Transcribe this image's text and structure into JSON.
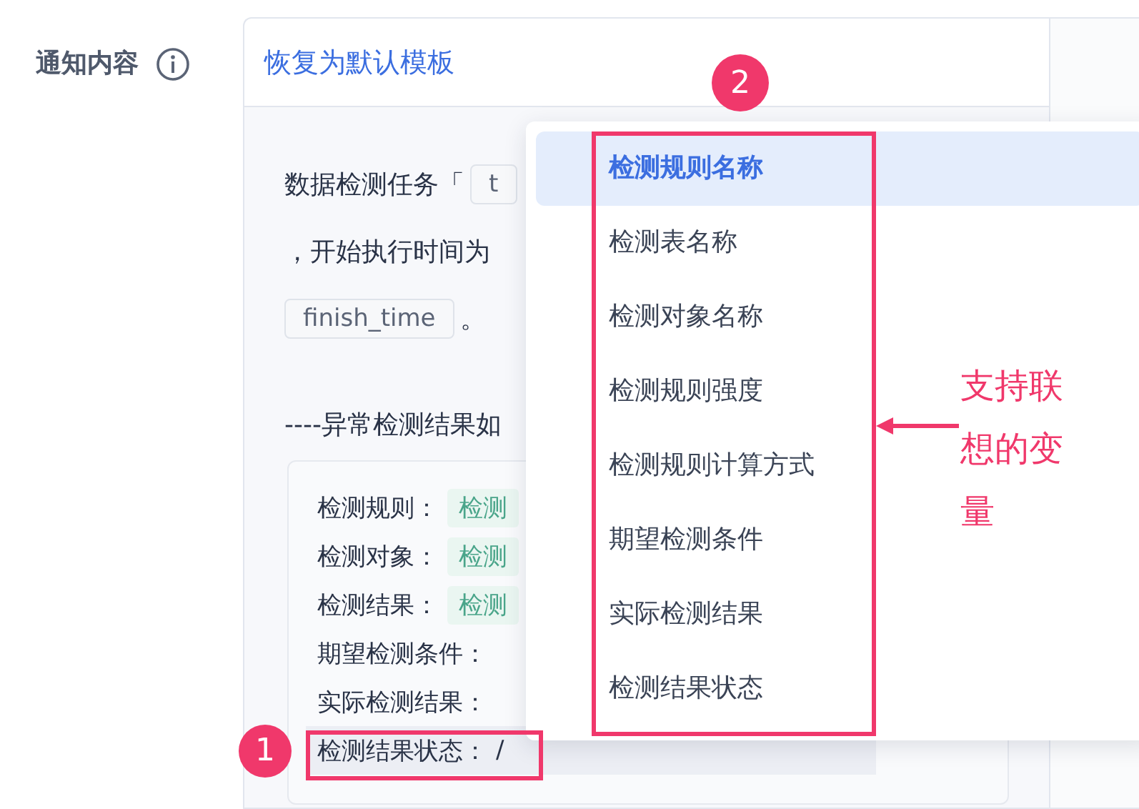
{
  "field": {
    "label": "通知内容",
    "reset_link": "恢复为默认模板"
  },
  "template": {
    "lines": [
      [
        {
          "kind": "text",
          "text": "数据检测任务「"
        },
        {
          "kind": "chip",
          "text": "t"
        }
      ],
      [
        {
          "kind": "text",
          "text": "，开始执行时间为"
        }
      ],
      [
        {
          "kind": "chip",
          "text": "finish_time"
        },
        {
          "kind": "text",
          "text": "。"
        }
      ]
    ],
    "section_heading": "----异常检测结果如",
    "result_rows": [
      {
        "label": "检测规则：",
        "value": {
          "kind": "chip",
          "text": "检测"
        },
        "highlighted": false
      },
      {
        "label": "检测对象：",
        "value": {
          "kind": "chip",
          "text": "检测"
        },
        "highlighted": false
      },
      {
        "label": "检测结果：",
        "value": {
          "kind": "chip",
          "text": "检测"
        },
        "highlighted": false
      },
      {
        "label": "期望检测条件：",
        "highlighted": false
      },
      {
        "label": "实际检测结果：",
        "highlighted": false
      },
      {
        "label": "检测结果状态：",
        "value": {
          "kind": "text",
          "text": "/"
        },
        "highlighted": true
      }
    ]
  },
  "dropdown": {
    "items": [
      {
        "label": "检测规则名称",
        "selected": true
      },
      {
        "label": "检测表名称",
        "selected": false
      },
      {
        "label": "检测对象名称",
        "selected": false
      },
      {
        "label": "检测规则强度",
        "selected": false
      },
      {
        "label": "检测规则计算方式",
        "selected": false
      },
      {
        "label": "期望检测条件",
        "selected": false
      },
      {
        "label": "实际检测结果",
        "selected": false
      },
      {
        "label": "检测结果状态",
        "selected": false
      }
    ]
  },
  "annotations": [
    {
      "kind": "badge",
      "text": "1"
    },
    {
      "kind": "badge",
      "text": "2"
    },
    {
      "kind": "callout",
      "text": "支持联想的变量"
    }
  ]
}
